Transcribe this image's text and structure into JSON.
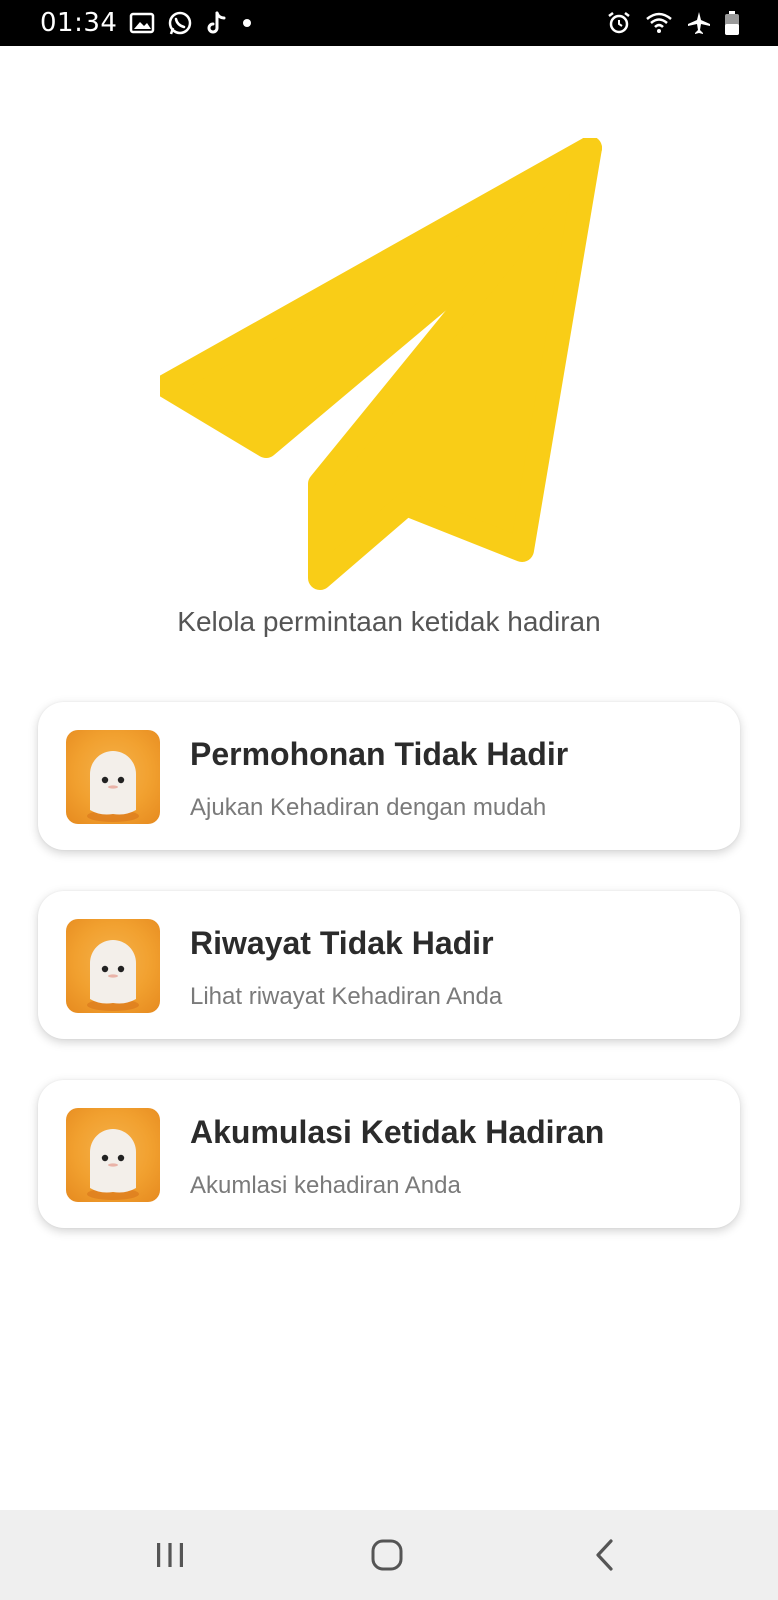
{
  "status_bar": {
    "time": "01:34",
    "left_icons": [
      "gallery-icon",
      "whatsapp-icon",
      "tiktok-icon",
      "dot-icon"
    ],
    "right_icons": [
      "alarm-icon",
      "wifi-icon",
      "airplane-icon",
      "battery-icon"
    ]
  },
  "hero": {
    "illustration": "paper-plane-icon",
    "subtitle": "Kelola permintaan ketidak hadiran"
  },
  "menu": [
    {
      "title": "Permohonan Tidak Hadir",
      "subtitle": "Ajukan Kehadiran dengan mudah",
      "icon": "ghost-icon"
    },
    {
      "title": "Riwayat Tidak Hadir",
      "subtitle": "Lihat riwayat Kehadiran Anda",
      "icon": "ghost-icon"
    },
    {
      "title": "Akumulasi Ketidak Hadiran",
      "subtitle": "Akumlasi kehadiran Anda",
      "icon": "ghost-icon"
    }
  ],
  "nav_bar": {
    "buttons": [
      "recents-icon",
      "home-icon",
      "back-icon"
    ]
  },
  "colors": {
    "accent_yellow": "#F9CD17",
    "icon_orange": "#F1A02F",
    "title_text": "#2B2B2B",
    "subtitle_text": "#7A7A7A"
  }
}
